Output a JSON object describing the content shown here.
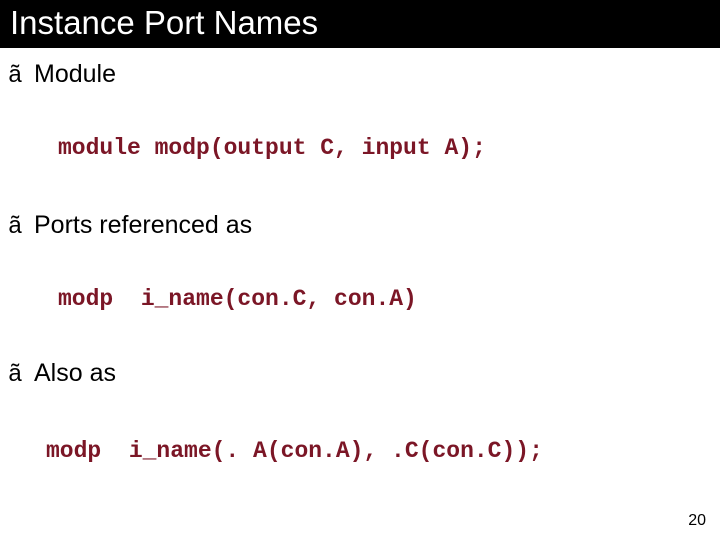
{
  "title": "Instance Port Names",
  "bullets": {
    "b1": {
      "glyph": "ã",
      "text": "Module"
    },
    "b2": {
      "glyph": "ã",
      "text": "Ports referenced as"
    },
    "b3": {
      "glyph": "ã",
      "text": "Also as"
    }
  },
  "code": {
    "c1": "module modp(output C, input A);",
    "c2": "modp  i_name(con.C, con.A)",
    "c3": "modp  i_name(. A(con.A), .C(con.C));"
  },
  "page_number": "20"
}
